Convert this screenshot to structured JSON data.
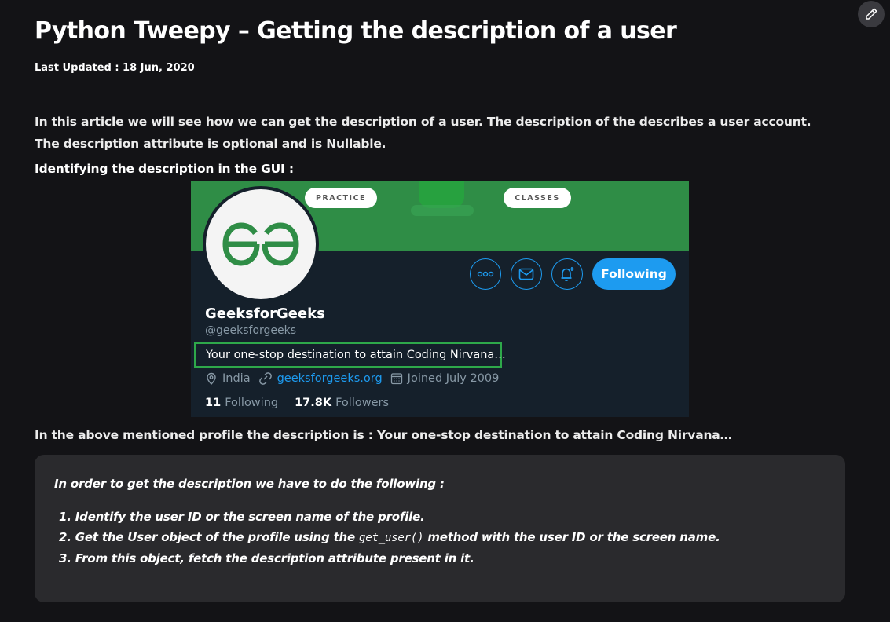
{
  "article": {
    "title": "Python Tweepy – Getting the description of a user",
    "last_updated": "Last Updated : 18 Jun, 2020",
    "intro": "In this article we will see how we can get the description of a user. The description of the describes a user account. The description attribute is optional and is Nullable.",
    "subheading": "Identifying the description in the GUI :",
    "after_image": "In the above mentioned profile the description is : Your one-stop destination to attain Coding Nirvana…"
  },
  "edit_button": {
    "icon": "pencil-icon"
  },
  "profile": {
    "banner_pills": [
      "PRACTICE",
      "CLASSES"
    ],
    "logo_text": "GG",
    "follow_label": "Following",
    "name": "GeeksforGeeks",
    "handle": "@geeksforgeeks",
    "description": "Your one-stop destination to attain Coding Nirvana…",
    "location": "India",
    "website": "geeksforgeeks.org",
    "joined": "Joined July 2009",
    "following_count": "11",
    "following_label": "Following",
    "followers_count": "17.8K",
    "followers_label": "Followers",
    "colors": {
      "banner": "#2f8d46",
      "accent": "#1d9bf0",
      "highlight": "#2ea84a",
      "card_bg": "#15202b"
    }
  },
  "note": {
    "intro": "In order to get the description we have to do the following :",
    "steps": [
      {
        "num": "1.",
        "text": "Identify the user ID or the screen name of the profile."
      },
      {
        "num": "2.",
        "pre": "Get the User object of the profile using the",
        "code": "get_user()",
        "post": "method with the user ID or the screen name."
      },
      {
        "num": "3.",
        "text": "From this object, fetch the description attribute present in it."
      }
    ]
  }
}
